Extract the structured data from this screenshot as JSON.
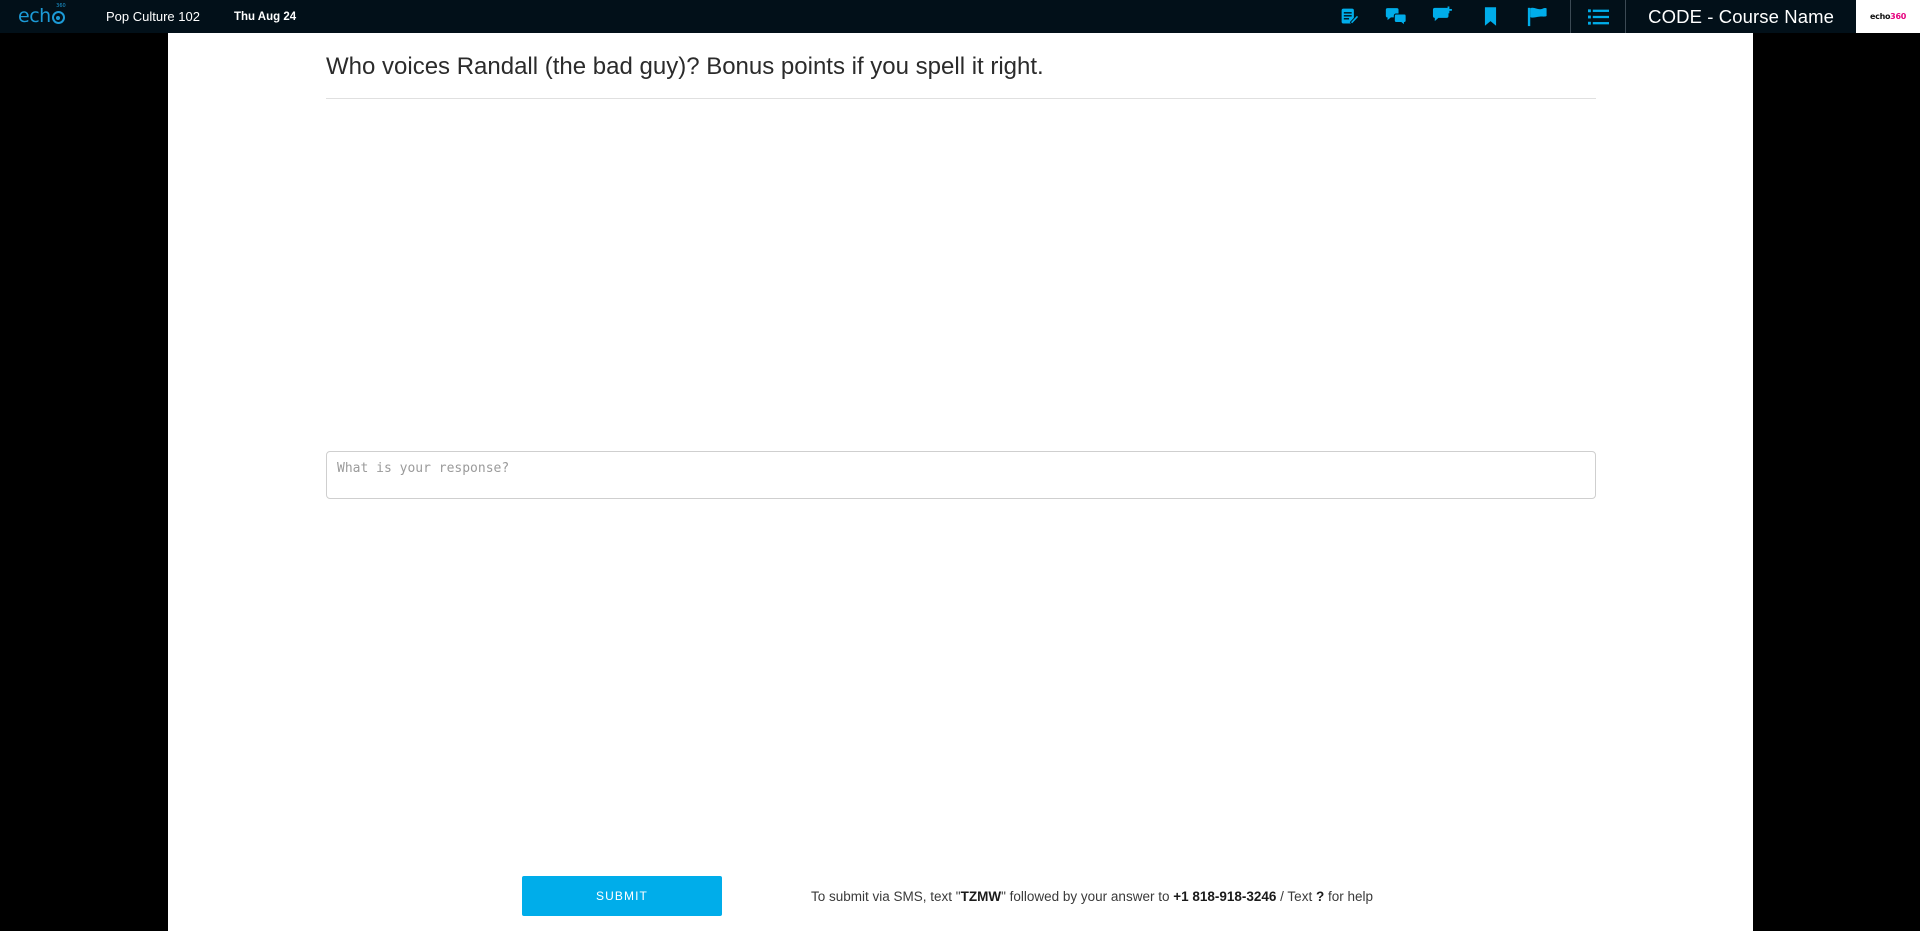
{
  "header": {
    "logo": {
      "wordmark": "ech",
      "superscript": "360",
      "icon_name": "echo-target-logo"
    },
    "course_title": "Pop Culture 102",
    "date": "Thu Aug 24",
    "code_course_name": "CODE - Course Name",
    "brand_logo": {
      "primary": "echo",
      "accent": "360"
    },
    "icons": [
      {
        "name": "note-edit-icon",
        "label": "Notes"
      },
      {
        "name": "discussion-icon",
        "label": "Discussions"
      },
      {
        "name": "add-comment-icon",
        "label": "Add Comment"
      },
      {
        "name": "bookmark-icon",
        "label": "Bookmark"
      },
      {
        "name": "flag-icon",
        "label": "Flag"
      },
      {
        "name": "list-menu-icon",
        "label": "Menu"
      }
    ],
    "colors": {
      "bar": "#021019",
      "icon": "#00adea",
      "logo": "#1c9ad6",
      "brand_accent": "#e6007e"
    }
  },
  "main": {
    "question": "Who voices Randall (the bad guy)? Bonus points if you spell it right.",
    "response": {
      "placeholder": "What is your response?",
      "value": ""
    },
    "submit_label": "SUBMIT",
    "sms": {
      "prefix": "To submit via SMS, text \"",
      "keyword": "TZMW",
      "middle": "\" followed by your answer to ",
      "phone": "+1 818-918-3246",
      "separator": " / Text ",
      "help_char": "?",
      "suffix": " for help"
    },
    "colors": {
      "panel": "#ffffff",
      "submit": "#00adea",
      "rule": "#e0e0e0"
    }
  }
}
